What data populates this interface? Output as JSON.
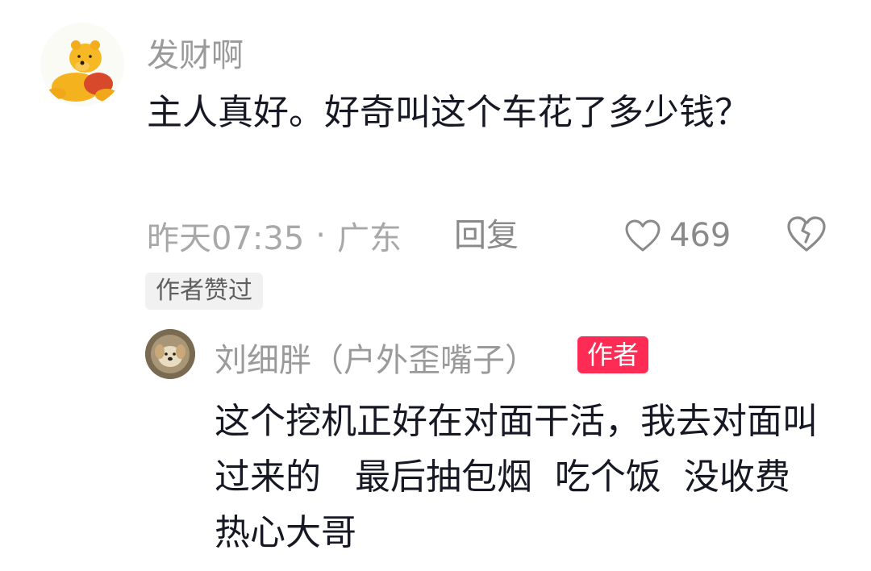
{
  "comment": {
    "username": "发财啊",
    "avatar_icon": "winnie-the-pooh-avatar",
    "text": "主人真好。好奇叫这个车花了多少钱？",
    "time": "昨天07:35",
    "separator": "·",
    "location": "广东",
    "reply_label": "回复",
    "like_icon": "heart-outline-icon",
    "like_count": "469",
    "dislike_icon": "broken-heart-icon",
    "author_liked_tag": "作者赞过"
  },
  "reply": {
    "username": "刘细胖（户外歪嘴子）",
    "avatar_icon": "puppy-avatar",
    "author_badge": "作者",
    "text": "这个挖机正好在对面干活，我去对面叫过来的   最后抽包烟  吃个饭  没收费   热心大哥"
  },
  "colors": {
    "accent": "#fe2c55",
    "text": "#161823",
    "muted": "#a8a8a8"
  }
}
